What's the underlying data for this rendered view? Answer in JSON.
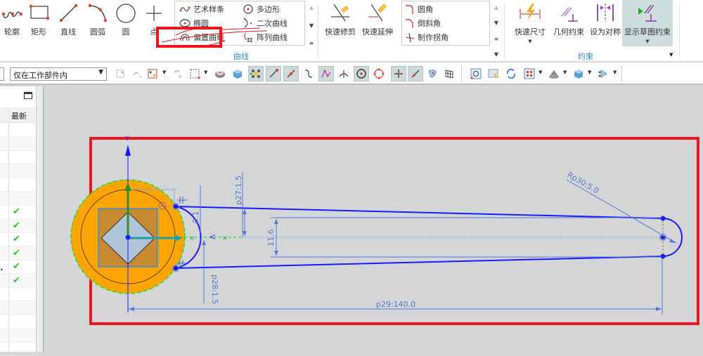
{
  "ribbon": {
    "big_buttons": [
      {
        "label": "轮廓",
        "icon": "profile-icon"
      },
      {
        "label": "矩形",
        "icon": "rectangle-icon"
      },
      {
        "label": "直线",
        "icon": "line-icon"
      },
      {
        "label": "圆弧",
        "icon": "arc-icon"
      },
      {
        "label": "圆",
        "icon": "circle-icon"
      },
      {
        "label": "点",
        "icon": "point-icon"
      }
    ],
    "curve_gallery": [
      {
        "label": "艺术样条",
        "icon": "studio-spline-icon"
      },
      {
        "label": "多边形",
        "icon": "polygon-icon"
      },
      {
        "label": "椭圆",
        "icon": "ellipse-icon"
      },
      {
        "label": "二次曲线",
        "icon": "conic-icon"
      },
      {
        "label": "偏置曲线",
        "icon": "offset-curve-icon"
      },
      {
        "label": "阵列曲线",
        "icon": "pattern-curve-icon"
      }
    ],
    "curve_group_label": "曲线",
    "edit_buttons": [
      {
        "label": "快速修剪",
        "icon": "quick-trim-icon"
      },
      {
        "label": "快速延伸",
        "icon": "quick-extend-icon"
      }
    ],
    "corner_gallery": [
      {
        "label": "圆角",
        "icon": "fillet-icon"
      },
      {
        "label": "倒斜角",
        "icon": "chamfer-icon"
      },
      {
        "label": "制作拐角",
        "icon": "make-corner-icon"
      }
    ],
    "constraint_buttons": [
      {
        "label": "快速尺寸",
        "icon": "rapid-dimension-icon",
        "has_dropdown": true
      },
      {
        "label": "几何约束",
        "icon": "geometric-constraint-icon",
        "has_dropdown": false
      },
      {
        "label": "设为对称",
        "icon": "make-symmetric-icon",
        "has_dropdown": false
      },
      {
        "label": "显示草图约束",
        "icon": "show-sketch-constraints-icon",
        "has_dropdown": true,
        "active": true
      }
    ],
    "constraint_group_label": "约束"
  },
  "toolbar": {
    "selection_scope": "仅在工作部件内"
  },
  "left_panel": {
    "column_header": "最新",
    "rows": [
      {
        "checked": false
      },
      {
        "checked": false
      },
      {
        "checked": false
      },
      {
        "checked": false
      },
      {
        "checked": false
      },
      {
        "checked": false
      },
      {
        "checked": true
      },
      {
        "checked": true
      },
      {
        "checked": true
      },
      {
        "checked": true
      },
      {
        "checked": true
      },
      {
        "checked": true
      },
      {
        "checked": false
      },
      {
        "checked": false
      },
      {
        "checked": false
      },
      {
        "checked": false
      },
      {
        "checked": false
      }
    ]
  },
  "sketch": {
    "dimensions": {
      "p27": "p27:1.5",
      "p28": "p28:1.5",
      "p29": "p29:140.0",
      "p30": "Rp30:5.0",
      "offset_gap": "0.1",
      "width": "11.6"
    },
    "colors": {
      "sketch_curve": "#1a1aff",
      "dimension": "#5577cc",
      "solid_orange": "#ffa500",
      "highlight_red": "#e8161e"
    }
  }
}
